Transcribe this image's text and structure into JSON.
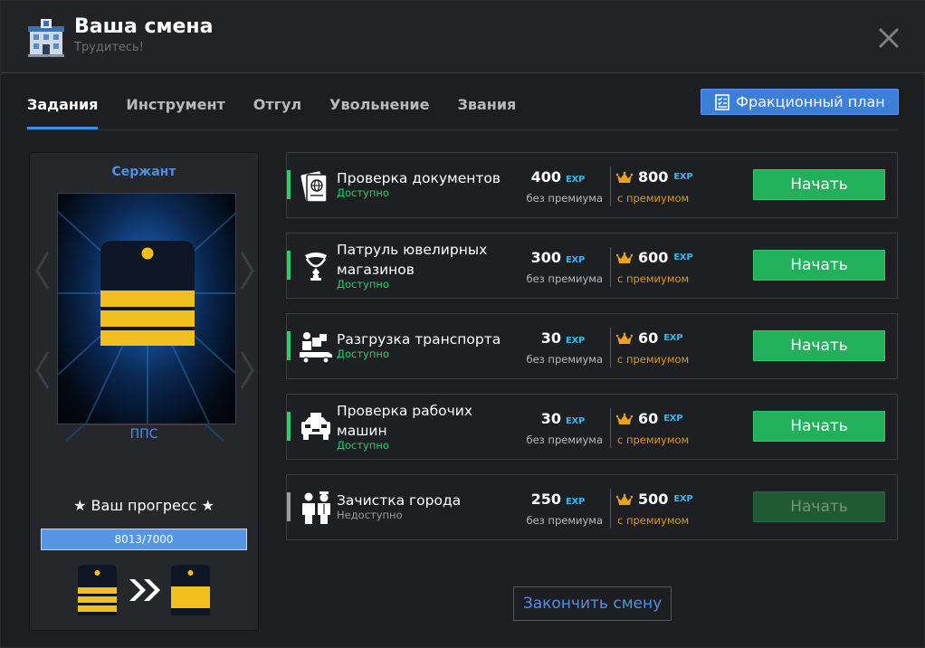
{
  "header": {
    "title": "Ваша смена",
    "subtitle": "Трудитесь!",
    "logo_icon": "police-station-icon",
    "close_icon": "close-icon"
  },
  "tabs": [
    {
      "label": "Задания",
      "active": true
    },
    {
      "label": "Инструмент",
      "active": false
    },
    {
      "label": "Отгул",
      "active": false
    },
    {
      "label": "Увольнение",
      "active": false
    },
    {
      "label": "Звания",
      "active": false
    }
  ],
  "plan_button": {
    "label": "Фракционный план",
    "icon": "checklist-icon"
  },
  "rank": {
    "name": "Сержант",
    "unit": "ППС",
    "progress_title": "★ Ваш прогресс ★",
    "progress_text": "8013/7000",
    "progress_fraction": 1.0
  },
  "tasks": [
    {
      "name": "Проверка документов",
      "status": "Доступно",
      "available": true,
      "exp": "400",
      "exp_premium": "800",
      "icon": "passport-icon"
    },
    {
      "name": "Патруль ювелирных магазинов",
      "status": "Доступно",
      "available": true,
      "exp": "300",
      "exp_premium": "600",
      "icon": "jewelry-icon"
    },
    {
      "name": "Разгрузка транспорта",
      "status": "Доступно",
      "available": true,
      "exp": "30",
      "exp_premium": "60",
      "icon": "truck-unload-icon"
    },
    {
      "name": "Проверка рабочих машин",
      "status": "Доступно",
      "available": true,
      "exp": "30",
      "exp_premium": "60",
      "icon": "taxi-icon"
    },
    {
      "name": "Зачистка города",
      "status": "Недоступно",
      "available": false,
      "exp": "250",
      "exp_premium": "500",
      "icon": "officers-icon"
    }
  ],
  "labels": {
    "exp": "EXP",
    "no_premium": "без премиума",
    "with_premium": "с премиумом",
    "start": "Начать"
  },
  "finish_button": "Закончить смену",
  "colors": {
    "accent_blue": "#3d8ee6",
    "available_green": "#2ecc71",
    "unavailable_gray": "#9a9ba0",
    "start_green": "#22b15a",
    "premium_orange": "#d99a24",
    "exp_cyan": "#36b8f0",
    "epaulette_gold": "#f2c01e",
    "epaulette_navy": "#0f1626"
  }
}
